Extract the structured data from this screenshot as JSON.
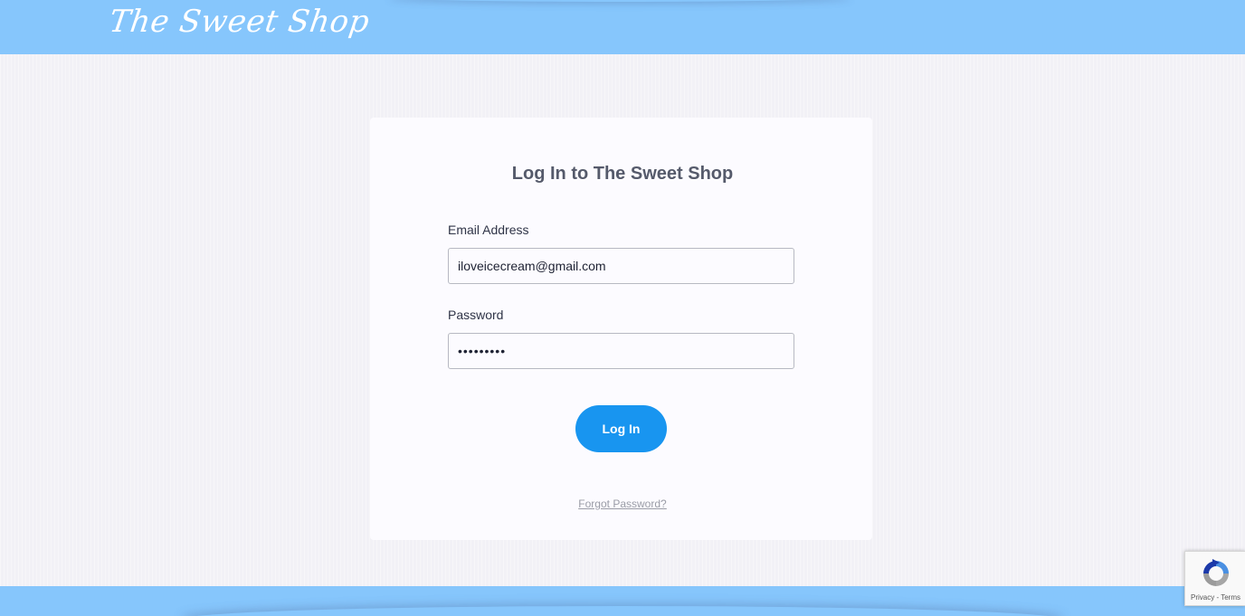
{
  "header": {
    "logo_text": "The Sweet Shop",
    "background_color": "#86c6fc"
  },
  "login": {
    "title": "Log In to The Sweet Shop",
    "email_label": "Email Address",
    "email_value": "iloveicecream@gmail.com",
    "password_label": "Password",
    "password_value": "shortcake",
    "submit_label": "Log In",
    "forgot_link": "Forgot Password?"
  },
  "recaptcha": {
    "icon": "recaptcha-icon",
    "privacy": "Privacy",
    "separator": " - ",
    "terms": "Terms"
  },
  "colors": {
    "accent": "#1895f0",
    "header": "#86c6fc",
    "page_bg": "#f2f1f6"
  }
}
